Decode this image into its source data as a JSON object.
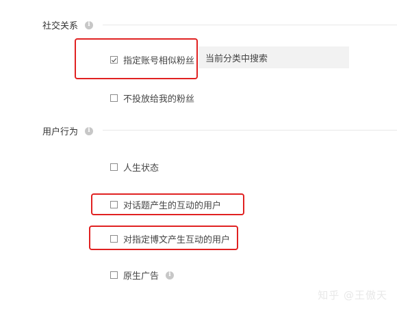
{
  "social": {
    "title": "社交关系",
    "options": [
      {
        "label": "指定账号相似粉丝",
        "checked": true
      },
      {
        "label": "不投放给我的粉丝",
        "checked": false
      }
    ],
    "search_hint": "当前分类中搜索"
  },
  "behavior": {
    "title": "用户行为",
    "options": [
      {
        "label": "人生状态",
        "checked": false
      },
      {
        "label": "对话题产生的互动的用户",
        "checked": false
      },
      {
        "label": "对指定博文产生互动的用户",
        "checked": false
      },
      {
        "label": "原生广告",
        "checked": false
      }
    ]
  },
  "info_glyph": "i",
  "watermark": "知乎 @王傲天",
  "colors": {
    "highlight": "#e02020",
    "checkbox_border": "#8a8a8a",
    "search_bg": "#f2f2f2"
  }
}
